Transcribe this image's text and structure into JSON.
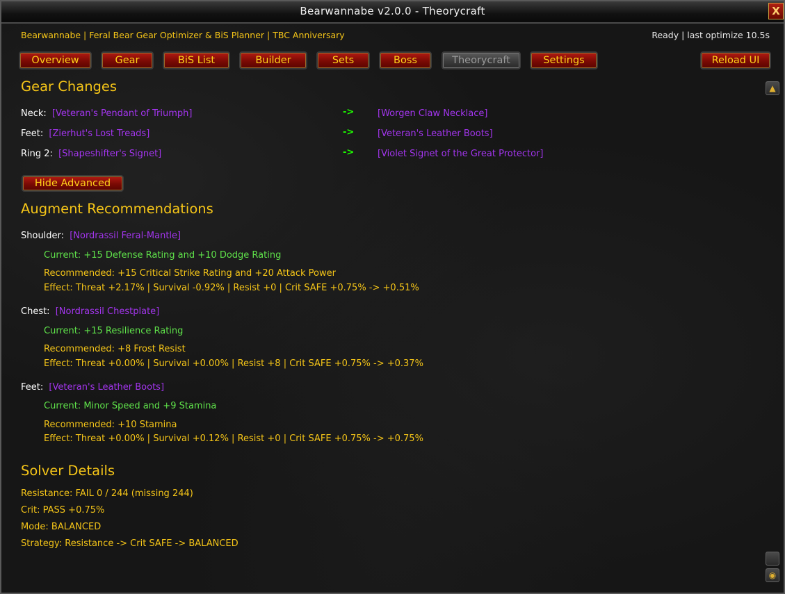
{
  "window": {
    "title": "Bearwannabe v2.0.0  -  Theorycraft",
    "close_label": "X"
  },
  "header": {
    "subtitle": "Bearwannabe | Feral Bear Gear Optimizer & BiS Planner | TBC Anniversary",
    "status": "Ready | last optimize 10.5s"
  },
  "tabs": [
    {
      "label": "Overview"
    },
    {
      "label": "Gear"
    },
    {
      "label": "BiS List"
    },
    {
      "label": "Builder"
    },
    {
      "label": "Sets"
    },
    {
      "label": "Boss"
    },
    {
      "label": "Theorycraft",
      "active": true
    },
    {
      "label": "Settings"
    }
  ],
  "reload_label": "Reload UI",
  "gear_changes": {
    "heading": "Gear Changes",
    "arrow": "->",
    "rows": [
      {
        "slot": "Neck:",
        "from": "[Veteran's Pendant of Triumph]",
        "to": "[Worgen Claw Necklace]"
      },
      {
        "slot": "Feet:",
        "from": "[Zierhut's Lost Treads]",
        "to": "[Veteran's Leather Boots]"
      },
      {
        "slot": "Ring 2:",
        "from": "[Shapeshifter's Signet]",
        "to": "[Violet Signet of the Great Protector]"
      }
    ]
  },
  "hide_advanced_label": "Hide Advanced",
  "augments": {
    "heading": "Augment Recommendations",
    "items": [
      {
        "slot": "Shoulder:",
        "item": "[Nordrassil Feral-Mantle]",
        "current": "Current: +15 Defense Rating and +10 Dodge Rating",
        "recommended": "Recommended: +15 Critical Strike Rating and +20 Attack Power",
        "effect": "Effect: Threat +2.17% | Survival -0.92% | Resist +0 | Crit SAFE +0.75% -> +0.51%"
      },
      {
        "slot": "Chest:",
        "item": "[Nordrassil Chestplate]",
        "current": "Current: +15 Resilience Rating",
        "recommended": "Recommended: +8 Frost Resist",
        "effect": "Effect: Threat +0.00% | Survival +0.00% | Resist +8 | Crit SAFE +0.75% -> +0.37%"
      },
      {
        "slot": "Feet:",
        "item": "[Veteran's Leather Boots]",
        "current": "Current: Minor Speed and +9 Stamina",
        "recommended": "Recommended: +10 Stamina",
        "effect": "Effect: Threat +0.00% | Survival +0.12% | Resist +0 | Crit SAFE +0.75% -> +0.75%"
      }
    ]
  },
  "solver": {
    "heading": "Solver Details",
    "lines": [
      "Resistance: FAIL 0 / 244 (missing 244)",
      "Crit: PASS +0.75%",
      "Mode: BALANCED",
      "Strategy: Resistance -> Crit SAFE -> BALANCED"
    ]
  },
  "colors": {
    "gold": "#f5c518",
    "epic": "#a335ee",
    "green": "#5fe24a",
    "arrow": "#1eff00"
  }
}
